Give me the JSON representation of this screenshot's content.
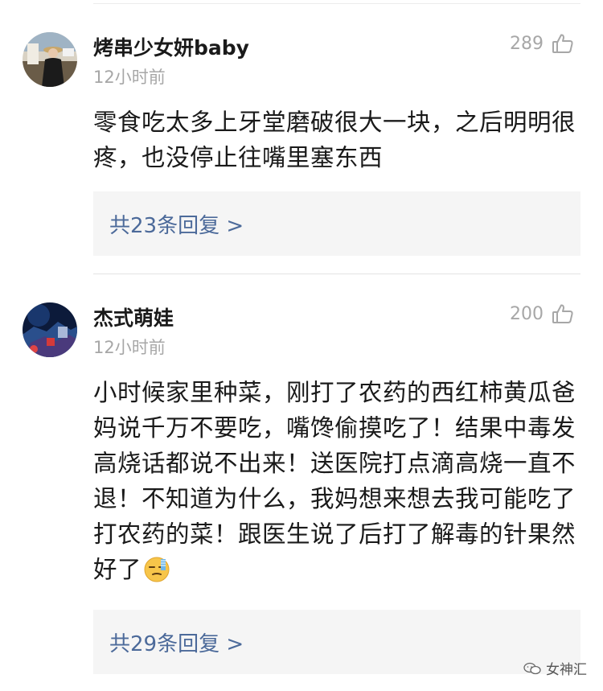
{
  "comments": [
    {
      "username": "烤串少女妍baby",
      "time": "12小时前",
      "likes": "289",
      "text": "零食吃太多上牙堂磨破很大一块，之后明明很疼，也没停止往嘴里塞东西",
      "reply_label": "共23条回复 >"
    },
    {
      "username": "杰式萌娃",
      "time": "12小时前",
      "likes": "200",
      "text": "小时候家里种菜，刚打了农药的西红柿黄瓜爸妈说千万不要吃，嘴馋偷摸吃了！结果中毒发高烧话都说不出来！送医院打点滴高烧一直不退！不知道为什么，我妈想来想去我可能吃了打农药的菜！跟医生说了后打了解毒的针果然好了",
      "reply_label": "共29条回复 >"
    }
  ],
  "watermark": "女神汇",
  "icons": {
    "like": "thumbs-up-icon",
    "emoji": "embarrassed-sweat-emoji-icon",
    "watermark": "wechat-icon"
  },
  "colors": {
    "reply_link": "#4c6a9a",
    "muted": "#a7a7a7",
    "reply_bg": "#f5f5f5"
  }
}
